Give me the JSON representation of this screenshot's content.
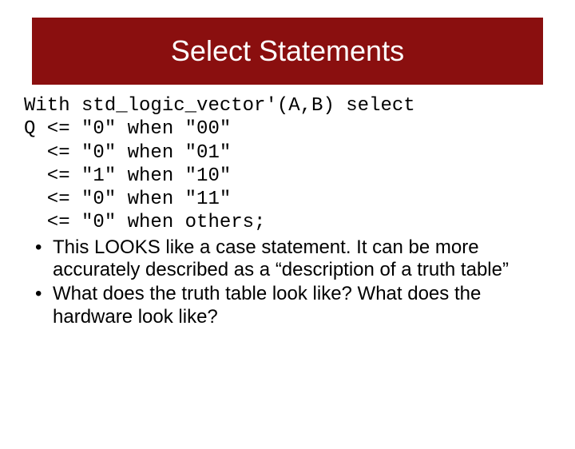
{
  "title": "Select Statements",
  "code": {
    "line1": "With std_logic_vector'(A,B) select",
    "line2": "Q <= \"0\" when \"00\"",
    "line3": "  <= \"0\" when \"01\"",
    "line4": "  <= \"1\" when \"10\"",
    "line5": "  <= \"0\" when \"11\"",
    "line6": "  <= \"0\" when others;"
  },
  "bullets": [
    "This LOOKS like a case statement. It can be more accurately described as a “description of a truth table”",
    "What does the truth table look like? What does the hardware look like?"
  ]
}
